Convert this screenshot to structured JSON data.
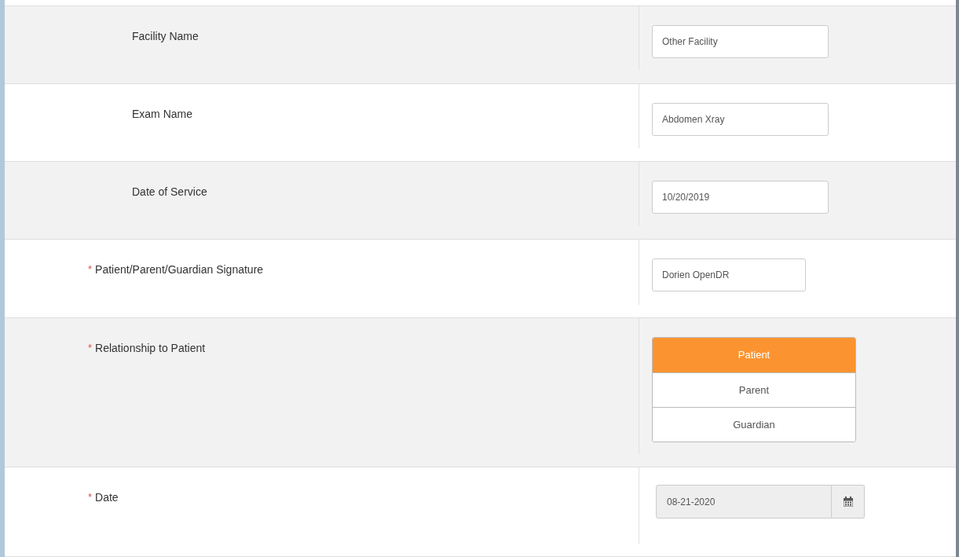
{
  "rows": [
    {
      "label": "Facility Name",
      "kind": "text",
      "value": "Other Facility"
    },
    {
      "label": "Exam Name",
      "kind": "text",
      "value": "Abdomen Xray"
    },
    {
      "label": "Date of Service",
      "kind": "text",
      "value": "10/20/2019"
    },
    {
      "required_mark": "*",
      "label": "Patient/Parent/Guardian Signature",
      "kind": "signature",
      "value": "Dorien OpenDR"
    },
    {
      "required_mark": "*",
      "label": "Relationship to Patient",
      "kind": "choice",
      "options": [
        {
          "label": "Patient",
          "selected": true
        },
        {
          "label": "Parent",
          "selected": false
        },
        {
          "label": "Guardian",
          "selected": false
        }
      ]
    },
    {
      "required_mark": "*",
      "label": "Date",
      "kind": "date",
      "value": "08-21-2020",
      "readonly": true
    }
  ]
}
